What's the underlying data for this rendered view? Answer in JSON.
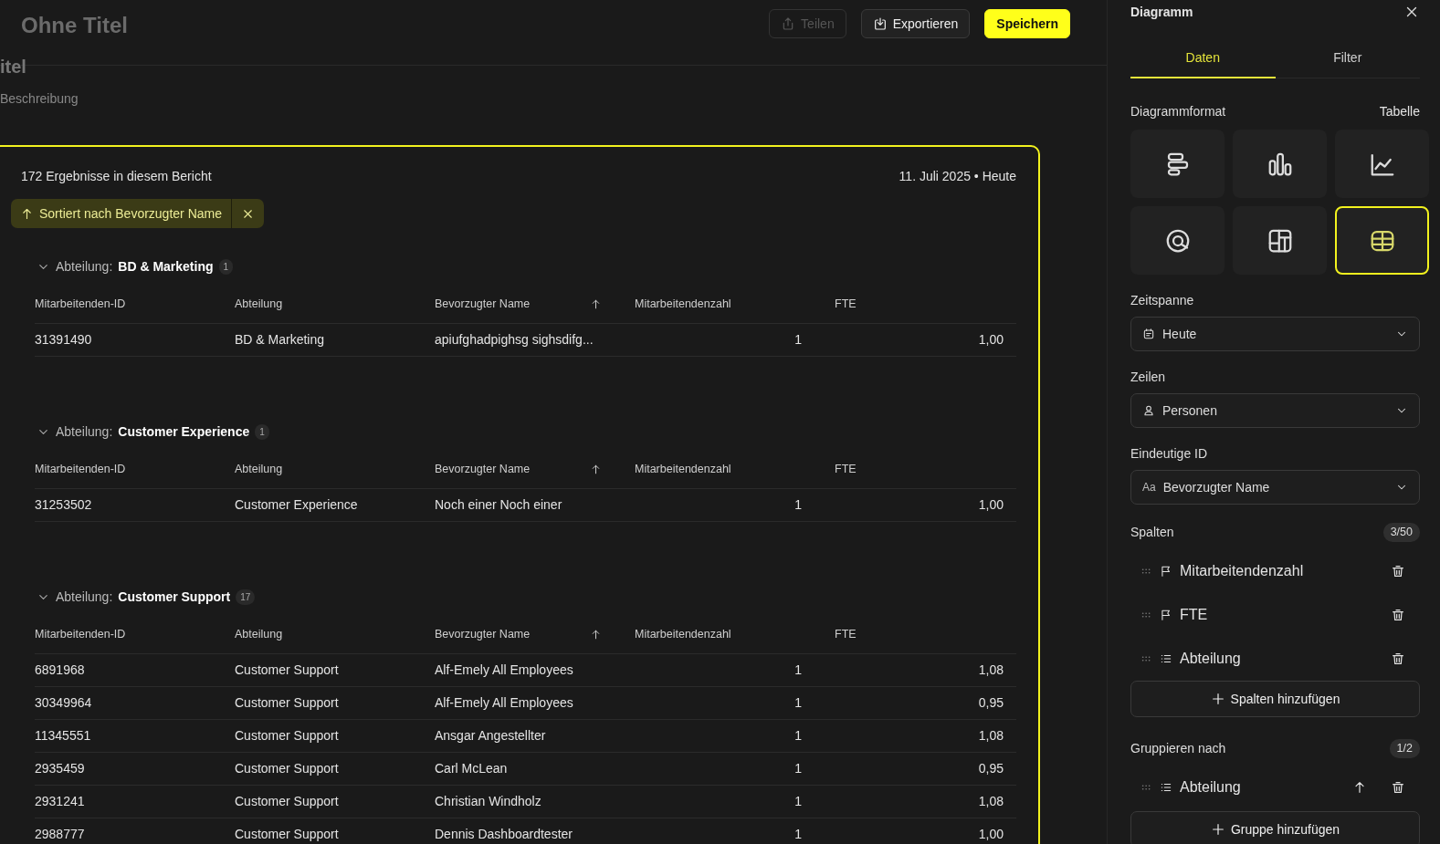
{
  "header": {
    "title": "Ohne Titel",
    "buttons": [
      {
        "label": "Teilen",
        "kind": "share",
        "disabled": true
      },
      {
        "label": "Exportieren",
        "kind": "export",
        "disabled": false
      },
      {
        "label": "Speichern",
        "kind": "save",
        "disabled": false
      }
    ]
  },
  "report": {
    "title_fragment": "itel",
    "description": "Beschreibung"
  },
  "result_card": {
    "summary": "172 Ergebnisse in diesem Bericht",
    "date": "11. Juli 2025 • Heute",
    "sort_chip": {
      "label": "Sortiert nach Bevorzugter Name"
    },
    "groups": [
      {
        "label": "Abteilung:",
        "value": "BD & Marketing",
        "count": "1",
        "expanded": true,
        "columns": [
          {
            "label": "Mitarbeitenden-ID",
            "sorted": false
          },
          {
            "label": "Abteilung",
            "sorted": false
          },
          {
            "label": "Bevorzugter Name",
            "sorted": true
          },
          {
            "label": "Mitarbeitendenzahl",
            "sorted": false
          },
          {
            "label": "FTE",
            "sorted": false
          }
        ],
        "rows": [
          [
            "31391490",
            "BD & Marketing",
            "apiufghadpighsg sighsdifg...",
            "1",
            "1,00"
          ]
        ]
      },
      {
        "label": "Abteilung:",
        "value": "Customer Experience",
        "count": "1",
        "expanded": true,
        "columns": [
          {
            "label": "Mitarbeitenden-ID",
            "sorted": false
          },
          {
            "label": "Abteilung",
            "sorted": false
          },
          {
            "label": "Bevorzugter Name",
            "sorted": true
          },
          {
            "label": "Mitarbeitendenzahl",
            "sorted": false
          },
          {
            "label": "FTE",
            "sorted": false
          }
        ],
        "rows": [
          [
            "31253502",
            "Customer Experience",
            "Noch einer Noch einer",
            "1",
            "1,00"
          ]
        ]
      },
      {
        "label": "Abteilung:",
        "value": "Customer Support",
        "count": "17",
        "expanded": true,
        "columns": [
          {
            "label": "Mitarbeitenden-ID",
            "sorted": false
          },
          {
            "label": "Abteilung",
            "sorted": false
          },
          {
            "label": "Bevorzugter Name",
            "sorted": true
          },
          {
            "label": "Mitarbeitendenzahl",
            "sorted": false
          },
          {
            "label": "FTE",
            "sorted": false
          }
        ],
        "rows": [
          [
            "6891968",
            "Customer Support",
            "Alf-Emely All Employees",
            "1",
            "1,08"
          ],
          [
            "30349964",
            "Customer Support",
            "Alf-Emely All Employees",
            "1",
            "0,95"
          ],
          [
            "11345551",
            "Customer Support",
            "Ansgar Angestellter",
            "1",
            "1,08"
          ],
          [
            "2935459",
            "Customer Support",
            "Carl McLean",
            "1",
            "0,95"
          ],
          [
            "2931241",
            "Customer Support",
            "Christian Windholz",
            "1",
            "1,08"
          ],
          [
            "2988777",
            "Customer Support",
            "Dennis Dashboardtester",
            "1",
            "1,00"
          ]
        ]
      }
    ]
  },
  "sidebar": {
    "title": "Diagramm",
    "tabs": [
      {
        "label": "Daten",
        "selected": true
      },
      {
        "label": "Filter",
        "selected": false
      }
    ],
    "format": {
      "label": "Diagrammformat",
      "current": "Tabelle",
      "options": [
        {
          "kind": "hbar",
          "selected": false
        },
        {
          "kind": "vbar",
          "selected": false
        },
        {
          "kind": "line",
          "selected": false
        },
        {
          "kind": "donut",
          "selected": false
        },
        {
          "kind": "treemap",
          "selected": false
        },
        {
          "kind": "table",
          "selected": true
        }
      ]
    },
    "fields": [
      {
        "label": "Zeitspanne",
        "value": "Heute",
        "kind": "date"
      },
      {
        "label": "Zeilen",
        "value": "Personen",
        "kind": "person"
      },
      {
        "label": "Eindeutige ID",
        "value": "Bevorzugter Name",
        "kind": "text",
        "prefix": "Aa"
      }
    ],
    "columns_section": {
      "label": "Spalten",
      "count": "3/50",
      "items": [
        {
          "label": "Mitarbeitendenzahl",
          "kind": "metric"
        },
        {
          "label": "FTE",
          "kind": "metric"
        },
        {
          "label": "Abteilung",
          "kind": "list"
        }
      ],
      "add_button": "Spalten hinzufügen"
    },
    "group_section": {
      "label": "Gruppieren nach",
      "count": "1/2",
      "items": [
        {
          "label": "Abteilung",
          "kind": "list",
          "ascending": true
        }
      ],
      "add_button": "Gruppe hinzufügen"
    }
  }
}
